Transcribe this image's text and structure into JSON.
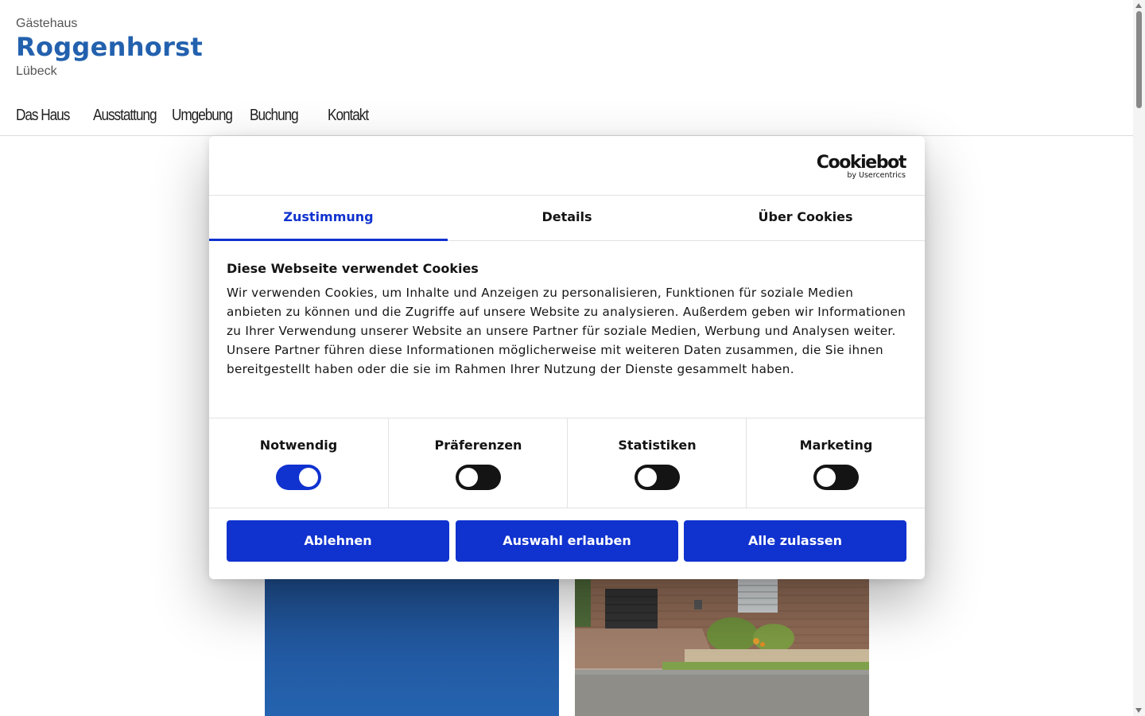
{
  "site": {
    "brand_pre": "Gästehaus",
    "brand_name": "Roggenhorst",
    "brand_city": "Lübeck"
  },
  "nav": {
    "items": [
      {
        "label": "Das Haus"
      },
      {
        "label": "Ausstattung"
      },
      {
        "label": "Umgebung"
      },
      {
        "label": "Buchung"
      },
      {
        "label": "Kontakt"
      }
    ]
  },
  "cookie_dialog": {
    "logo_main": "Cookiebot",
    "logo_sub": "by Usercentrics",
    "tabs": [
      {
        "label": "Zustimmung",
        "active": true
      },
      {
        "label": "Details",
        "active": false
      },
      {
        "label": "Über Cookies",
        "active": false
      }
    ],
    "title": "Diese Webseite verwendet Cookies",
    "text": "Wir verwenden Cookies, um Inhalte und Anzeigen zu personalisieren, Funktionen für soziale Medien anbieten zu können und die Zugriffe auf unsere Website zu analysieren. Außerdem geben wir Informationen zu Ihrer Verwendung unserer Website an unsere Partner für soziale Medien, Werbung und Analysen weiter. Unsere Partner führen diese Informationen möglicherweise mit weiteren Daten zusammen, die Sie ihnen bereitgestellt haben oder die sie im Rahmen Ihrer Nutzung der Dienste gesammelt haben.",
    "toggles": [
      {
        "label": "Notwendig",
        "on": true
      },
      {
        "label": "Präferenzen",
        "on": false
      },
      {
        "label": "Statistiken",
        "on": false
      },
      {
        "label": "Marketing",
        "on": false
      }
    ],
    "buttons": {
      "decline": "Ablehnen",
      "allow_selection": "Auswahl erlauben",
      "allow_all": "Alle zulassen"
    }
  },
  "colors": {
    "brand_blue": "#2361ae",
    "cookiebot_blue": "#1032cf",
    "toggle_off": "#141414"
  }
}
